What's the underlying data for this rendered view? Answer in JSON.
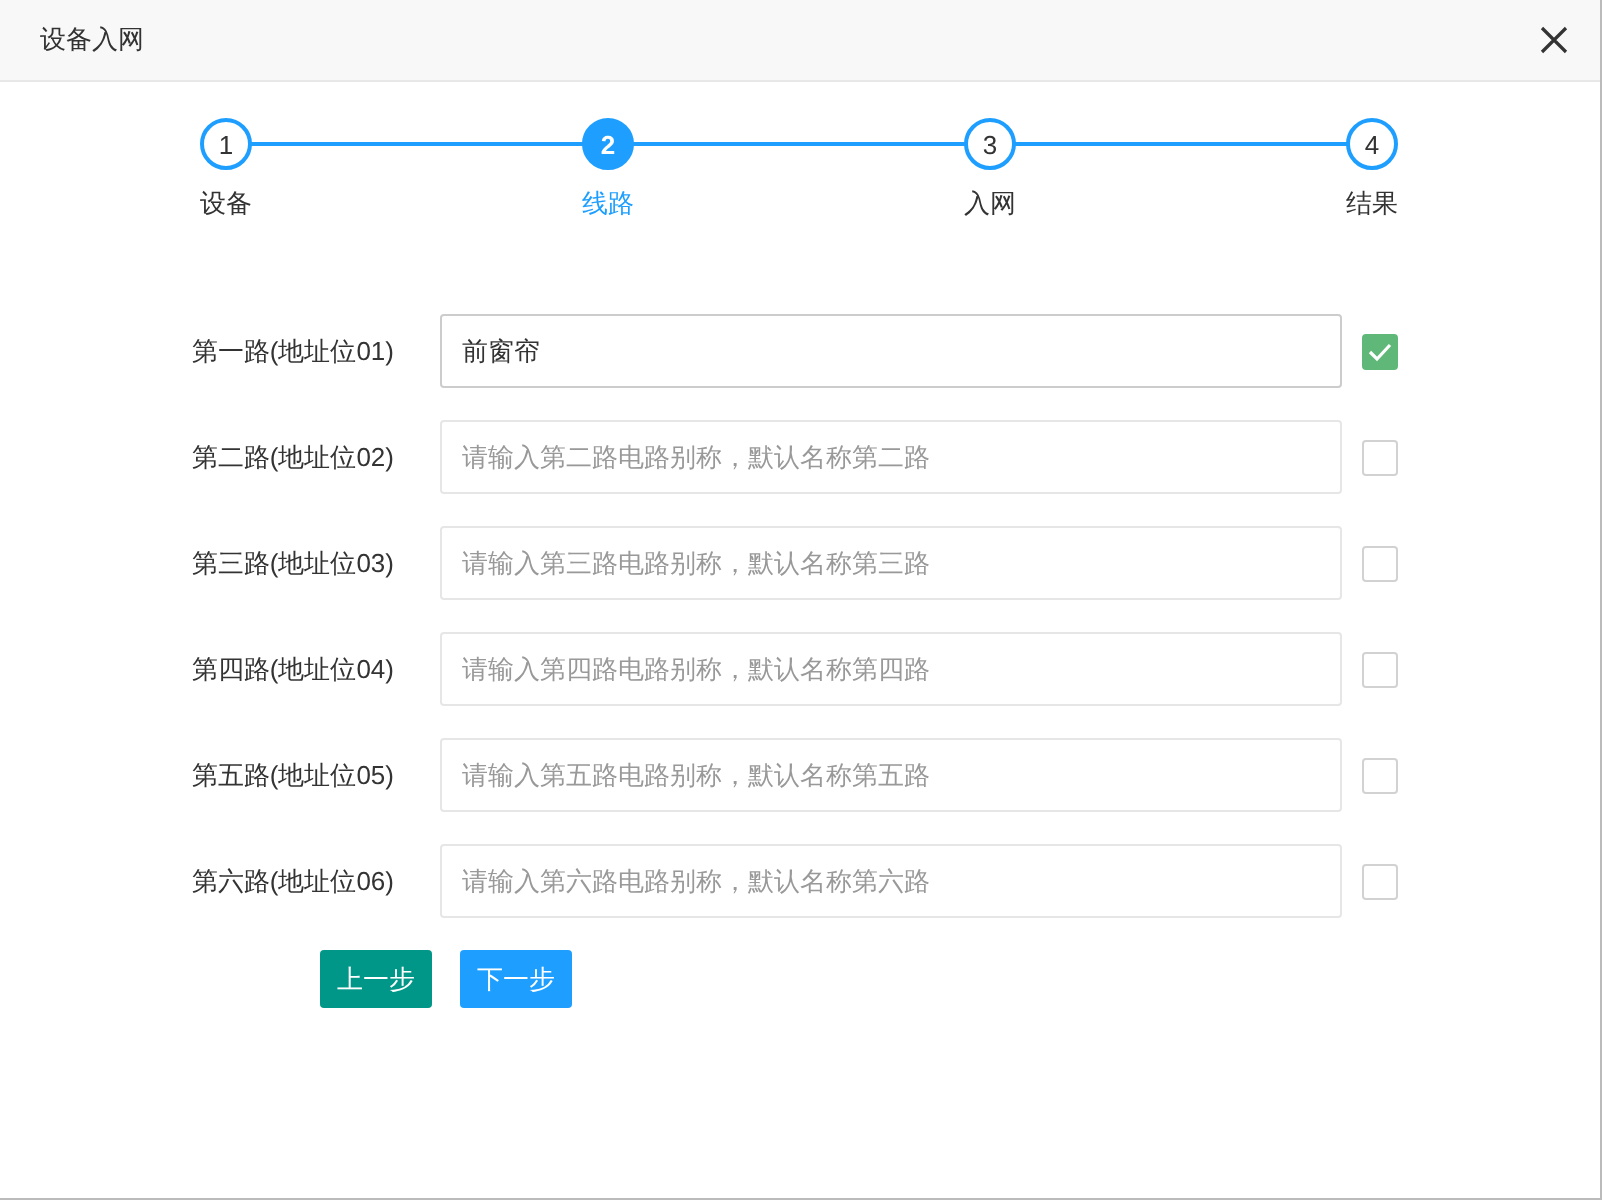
{
  "window": {
    "title": "设备入网"
  },
  "steps": [
    {
      "number": "1",
      "label": "设备",
      "selected": false
    },
    {
      "number": "2",
      "label": "线路",
      "selected": true
    },
    {
      "number": "3",
      "label": "入网",
      "selected": false
    },
    {
      "number": "4",
      "label": "结果",
      "selected": false
    }
  ],
  "circuits": [
    {
      "label": "第一路(地址位01)",
      "value": "前窗帘",
      "checked": true
    },
    {
      "label": "第二路(地址位02)",
      "placeholder": "请输入第二路电路别称，默认名称第二路",
      "checked": false
    },
    {
      "label": "第三路(地址位03)",
      "placeholder": "请输入第三路电路别称，默认名称第三路",
      "checked": false
    },
    {
      "label": "第四路(地址位04)",
      "placeholder": "请输入第四路电路别称，默认名称第四路",
      "checked": false
    },
    {
      "label": "第五路(地址位05)",
      "placeholder": "请输入第五路电路别称，默认名称第五路",
      "checked": false
    },
    {
      "label": "第六路(地址位06)",
      "placeholder": "请输入第六路电路别称，默认名称第六路",
      "checked": false
    }
  ],
  "buttons": [
    {
      "label": "上一步",
      "kind": "prev"
    },
    {
      "label": "下一步",
      "kind": "next"
    }
  ]
}
